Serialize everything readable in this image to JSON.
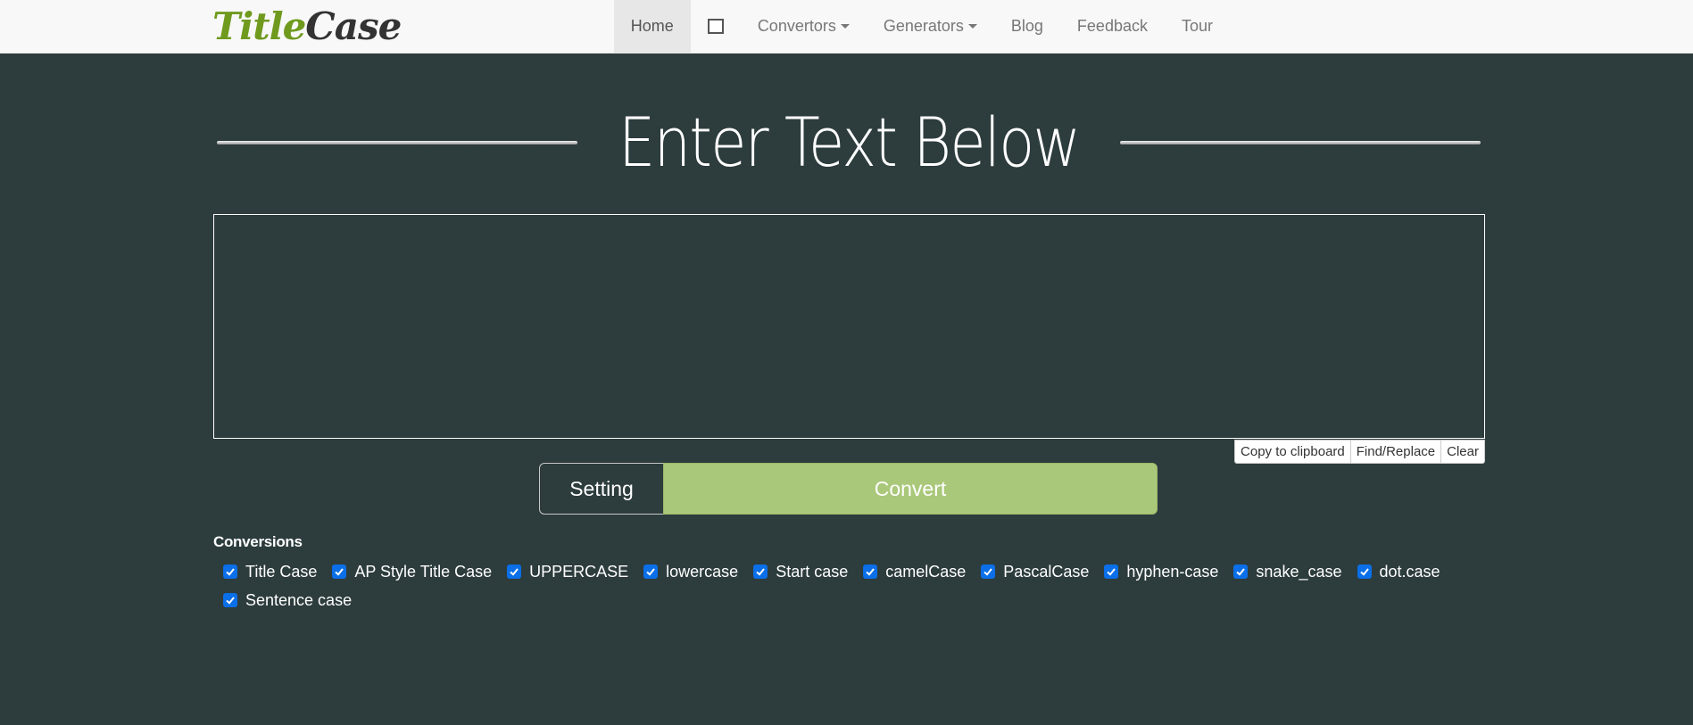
{
  "logo": {
    "part1": "Title",
    "part2": "Case"
  },
  "nav": {
    "items": [
      {
        "label": "Home",
        "active": true
      },
      {
        "label": "",
        "icon": "checkbox-square-icon"
      },
      {
        "label": "Convertors",
        "dropdown": true
      },
      {
        "label": "Generators",
        "dropdown": true
      },
      {
        "label": "Blog"
      },
      {
        "label": "Feedback"
      },
      {
        "label": "Tour"
      }
    ]
  },
  "heading": "Enter Text Below",
  "textarea": {
    "value": "",
    "placeholder": ""
  },
  "tools": {
    "copy": "Copy to clipboard",
    "find_replace": "Find/Replace",
    "clear": "Clear"
  },
  "actions": {
    "setting": "Setting",
    "convert": "Convert"
  },
  "conversions": {
    "title": "Conversions",
    "items": [
      {
        "label": "Title Case",
        "checked": true
      },
      {
        "label": "AP Style Title Case",
        "checked": true
      },
      {
        "label": "UPPERCASE",
        "checked": true
      },
      {
        "label": "lowercase",
        "checked": true
      },
      {
        "label": "Start case",
        "checked": true
      },
      {
        "label": "camelCase",
        "checked": true
      },
      {
        "label": "PascalCase",
        "checked": true
      },
      {
        "label": "hyphen-case",
        "checked": true
      },
      {
        "label": "snake_case",
        "checked": true
      },
      {
        "label": "dot.case",
        "checked": true
      },
      {
        "label": "Sentence case",
        "checked": true
      }
    ]
  },
  "colors": {
    "background": "#2d3c3d",
    "accent": "#aac87a",
    "logo_green": "#6f9a1e",
    "checkbox": "#0a6fe8"
  }
}
